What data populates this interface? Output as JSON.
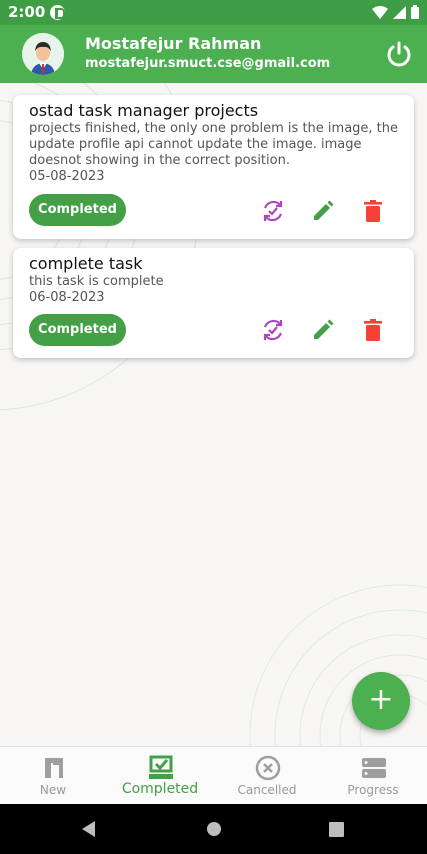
{
  "status_bar": {
    "time": "2:00"
  },
  "header": {
    "user_name": "Mostafejur Rahman",
    "user_email": "mostafejur.smuct.cse@gmail.com"
  },
  "tasks": [
    {
      "title": "ostad task manager projects",
      "description": "projects finished, the only one problem is the image, the update profile api cannot update the image. image doesnot showing in the correct position.",
      "date": "05-08-2023",
      "status": "Completed"
    },
    {
      "title": "complete task",
      "description": "this task is complete",
      "date": "06-08-2023",
      "status": "Completed"
    }
  ],
  "bottom_nav": {
    "items": [
      {
        "label": "New",
        "icon": "new-task-icon"
      },
      {
        "label": "Completed",
        "icon": "completed-icon"
      },
      {
        "label": "Cancelled",
        "icon": "cancelled-icon"
      },
      {
        "label": "Progress",
        "icon": "progress-icon"
      }
    ],
    "active": "Completed"
  },
  "colors": {
    "primary": "#4caf50",
    "status_bar": "#3f9d46",
    "badge": "#43a047",
    "edit": "#43a047",
    "delete": "#f44336",
    "change_status": "#ab47bc",
    "inactive_nav": "#999999"
  },
  "fab": {
    "icon": "add-icon",
    "label": "+"
  }
}
